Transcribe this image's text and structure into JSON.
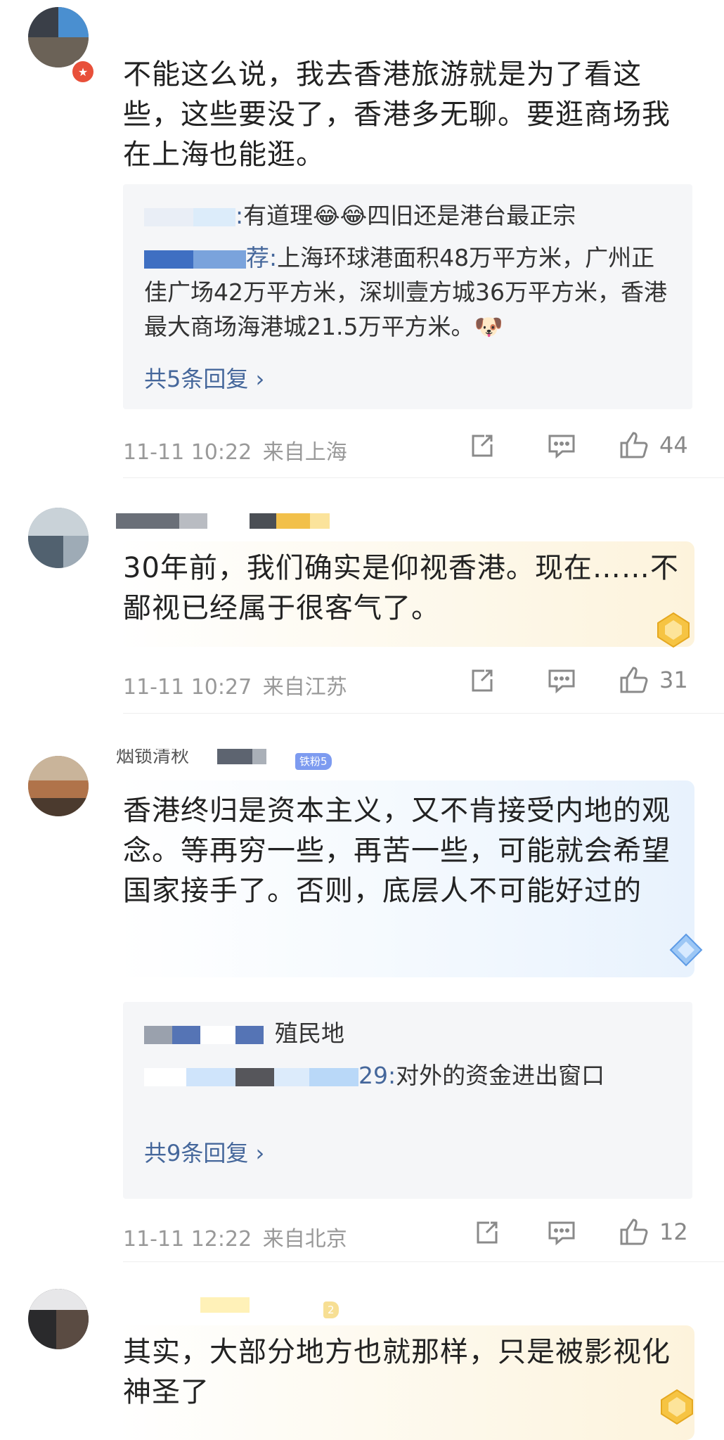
{
  "comments": [
    {
      "text": "不能这么说，我去香港旅游就是为了看这些，这些要没了，香港多无聊。要逛商场我在上海也能逛。",
      "replies": [
        {
          "name_suffix": ":",
          "text": "有道理😂😂四旧还是港台最正宗"
        },
        {
          "name_suffix": "荐:",
          "text": "上海环球港面积48万平方米，广州正佳广场42万平方米，深圳壹方城36万平方米，香港最大商场海港城21.5万平方米。🐶"
        }
      ],
      "more": "共5条回复 ›",
      "time": "11-11 10:22",
      "location": "来自上海",
      "likes": "44"
    },
    {
      "text": "30年前，我们确实是仰视香港。现在……不鄙视已经属于很客气了。",
      "time": "11-11 10:27",
      "location": "来自江苏",
      "likes": "31"
    },
    {
      "name": "烟锁清秋",
      "badge": "铁粉5",
      "text": "香港终归是资本主义，又不肯接受内地的观念。等再穷一些，再苦一些，可能就会希望国家接手了。否则，底层人不可能好过的",
      "replies": [
        {
          "name_suffix": "",
          "text": "殖民地"
        },
        {
          "name_suffix": "29:",
          "text": "对外的资金进出窗口"
        }
      ],
      "more": "共9条回复 ›",
      "time": "11-11 12:22",
      "location": "来自北京",
      "likes": "12"
    },
    {
      "badge": "2",
      "text": "其实，大部分地方也就那样，只是被影视化神圣了"
    }
  ],
  "icons": {
    "repost": "repost-icon",
    "comment": "comment-icon",
    "like": "thumbs-up-icon",
    "vip": "vip-badge-icon"
  },
  "colors": {
    "link": "#45679b",
    "meta": "#999999",
    "reply_bg": "#f5f6f8",
    "highlight_gold": "#fdf6e3",
    "highlight_blue": "#eef5fd"
  }
}
